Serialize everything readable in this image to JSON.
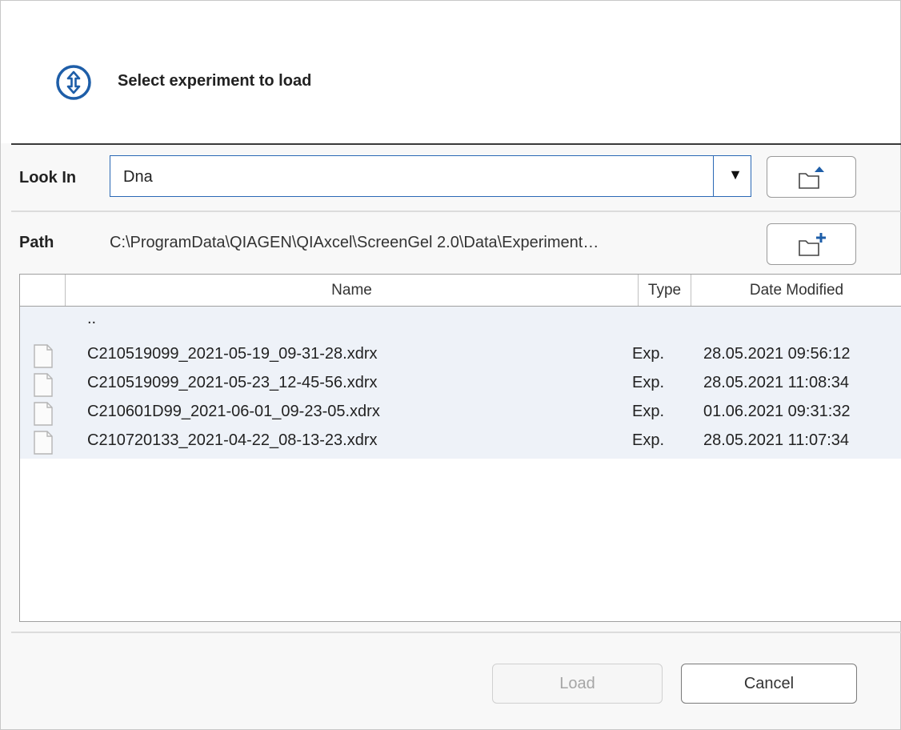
{
  "header": {
    "title": "Select experiment to load",
    "icon": "up-down-arrows-icon",
    "accent_color": "#1e5ea8"
  },
  "look_in": {
    "label": "Look In",
    "value": "Dna"
  },
  "path": {
    "label": "Path",
    "value": "C:\\ProgramData\\QIAGEN\\QIAxcel\\ScreenGel 2.0\\Data\\Experiment…"
  },
  "table": {
    "columns": {
      "name": "Name",
      "type": "Type",
      "date": "Date Modified"
    },
    "parent_entry": "..",
    "rows": [
      {
        "name": "C210519099_2021-05-19_09-31-28.xdrx",
        "type": "Exp.",
        "date": "28.05.2021 09:56:12"
      },
      {
        "name": "C210519099_2021-05-23_12-45-56.xdrx",
        "type": "Exp.",
        "date": "28.05.2021 11:08:34"
      },
      {
        "name": "C210601D99_2021-06-01_09-23-05.xdrx",
        "type": "Exp.",
        "date": "01.06.2021 09:31:32"
      },
      {
        "name": "C210720133_2021-04-22_08-13-23.xdrx",
        "type": "Exp.",
        "date": "28.05.2021 11:07:34"
      }
    ]
  },
  "buttons": {
    "load": "Load",
    "cancel": "Cancel"
  }
}
